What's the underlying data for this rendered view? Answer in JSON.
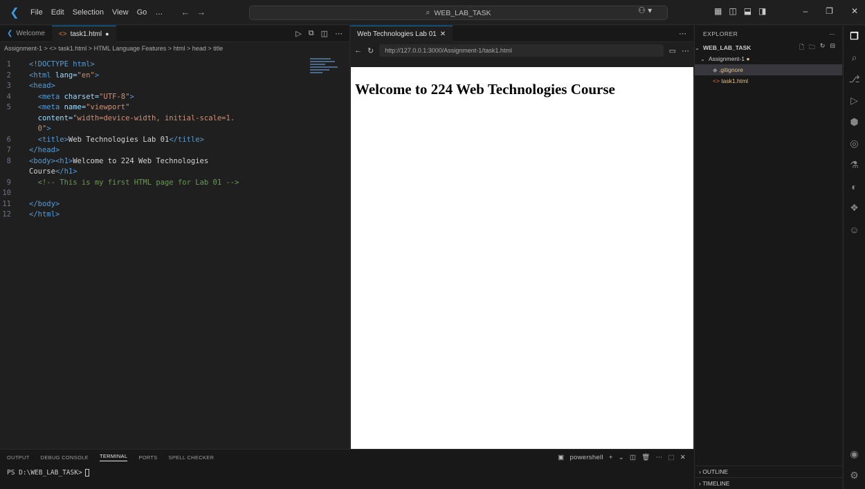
{
  "titlebar": {
    "menu": [
      "File",
      "Edit",
      "Selection",
      "View",
      "Go",
      "…"
    ],
    "search_text": "WEB_LAB_TASK"
  },
  "editor": {
    "tabs": [
      {
        "label": "Welcome"
      },
      {
        "label": "task1.html"
      }
    ],
    "breadcrumb": "Assignment-1 > <> task1.html > HTML Language Features > html > head > title",
    "lines": [
      {
        "n": "1"
      },
      {
        "n": "2"
      },
      {
        "n": "3"
      },
      {
        "n": "4"
      },
      {
        "n": "5"
      },
      {
        "n": ""
      },
      {
        "n": "6"
      },
      {
        "n": "7"
      },
      {
        "n": "8"
      },
      {
        "n": ""
      },
      {
        "n": "9"
      },
      {
        "n": "10"
      },
      {
        "n": "11"
      },
      {
        "n": "12"
      }
    ],
    "code": {
      "doctype": "<!DOCTYPE html>",
      "html_open": "<html",
      "lang_attr": " lang=",
      "lang_val": "\"en\"",
      "gt": ">",
      "head_open": "<head>",
      "meta1_tag": "<meta",
      "meta1_attr": " charset=",
      "meta1_val": "\"UTF-8\"",
      "meta2_tag": "<meta",
      "meta2_attr": " name=",
      "meta2_val": "\"viewport\"",
      "content_attr": "content=",
      "content_val": "\"width=device-width, initial-scale=1.",
      "content_val2": "0\"",
      "title_open": "<title>",
      "title_text": "Web Technologies Lab 01",
      "title_close": "</title>",
      "head_close": "</head>",
      "body_open": "<body>",
      "h1_open": "<h1>",
      "h1_text": "Welcome to 224 Web Technologies",
      "h1_text2": "Course",
      "h1_close": "</h1>",
      "comment": "<!-- This is my first HTML page for Lab 01 -->",
      "body_close": "</body>",
      "html_close": "</html>"
    }
  },
  "preview": {
    "tab_label": "Web Technologies Lab 01",
    "url": "http://127.0.0.1:3000/Assignment-1/task1.html",
    "heading": "Welcome to 224 Web Technologies Course"
  },
  "explorer": {
    "header": "EXPLORER",
    "root": "WEB_LAB_TASK",
    "folder": "Assignment-1",
    "items": [
      ".gitignore",
      "task1.html"
    ],
    "outline": "OUTLINE",
    "timeline": "TIMELINE"
  },
  "panel": {
    "tabs": [
      "OUTPUT",
      "DEBUG CONSOLE",
      "TERMINAL",
      "PORTS",
      "SPELL CHECKER"
    ],
    "active_tab": "TERMINAL",
    "shell": "powershell",
    "prompt": "PS D:\\WEB_LAB_TASK>"
  },
  "colors": {
    "accent": "#0078d4",
    "background": "#1f1f1f",
    "sidebar": "#181818"
  }
}
